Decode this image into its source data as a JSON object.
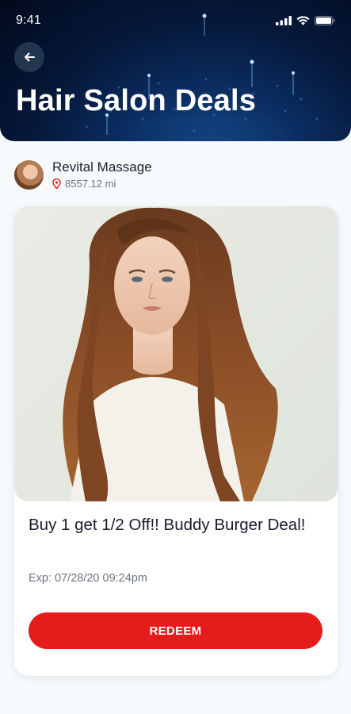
{
  "status_bar": {
    "time": "9:41",
    "icons": [
      "signal-icon",
      "wifi-icon",
      "battery-icon"
    ]
  },
  "header": {
    "title": "Hair Salon Deals",
    "back_icon": "back-arrow-icon"
  },
  "merchant": {
    "name": "Revital Massage",
    "distance": "8557.12 mi",
    "pin_icon": "location-pin-icon"
  },
  "deal": {
    "title": "Buy 1 get 1/2 Off!! Buddy Burger Deal!",
    "expiry": "Exp: 07/28/20 09:24pm",
    "redeem_label": "REDEEM"
  },
  "colors": {
    "accent": "#e61c1c",
    "header_dark": "#061a3d",
    "text_primary": "#1b1b2e",
    "text_muted": "#6d7480"
  }
}
